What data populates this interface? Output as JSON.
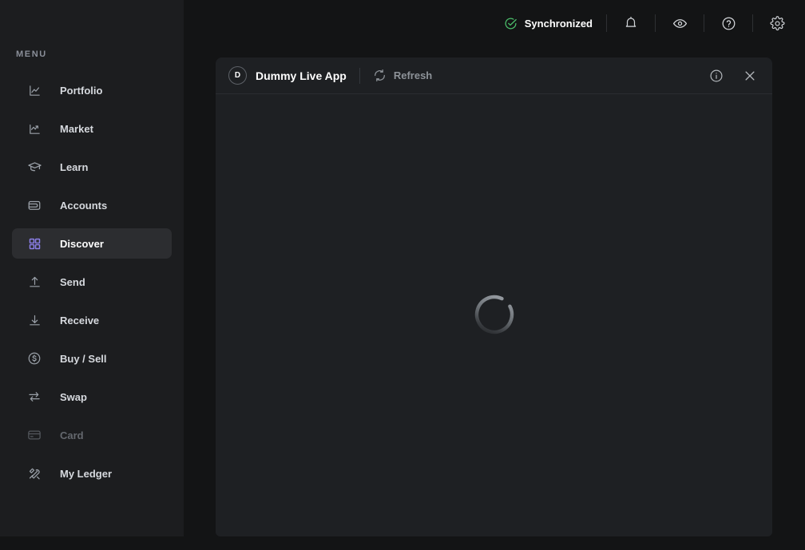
{
  "colors": {
    "app_background": "#131415",
    "sidebar_background": "#1c1d1f",
    "panel_background": "#1e2023",
    "active_item_background": "#2c2d30",
    "accent_purple": "#8b7fe8",
    "status_green": "#4bbf6b",
    "text_primary": "#ffffff",
    "text_secondary": "#8d9298",
    "text_disabled": "#64686e"
  },
  "sidebar": {
    "section_label": "MENU",
    "items": [
      {
        "label": "Portfolio",
        "icon": "line-chart-icon",
        "active": false,
        "disabled": false
      },
      {
        "label": "Market",
        "icon": "trending-up-icon",
        "active": false,
        "disabled": false
      },
      {
        "label": "Learn",
        "icon": "graduation-cap-icon",
        "active": false,
        "disabled": false
      },
      {
        "label": "Accounts",
        "icon": "wallet-icon",
        "active": false,
        "disabled": false
      },
      {
        "label": "Discover",
        "icon": "grid-squares-icon",
        "active": true,
        "disabled": false
      },
      {
        "label": "Send",
        "icon": "arrow-up-tray-icon",
        "active": false,
        "disabled": false
      },
      {
        "label": "Receive",
        "icon": "arrow-down-icon",
        "active": false,
        "disabled": false
      },
      {
        "label": "Buy / Sell",
        "icon": "dollar-circle-icon",
        "active": false,
        "disabled": false
      },
      {
        "label": "Swap",
        "icon": "swap-arrows-icon",
        "active": false,
        "disabled": false
      },
      {
        "label": "Card",
        "icon": "credit-card-icon",
        "active": false,
        "disabled": true
      },
      {
        "label": "My Ledger",
        "icon": "tools-icon",
        "active": false,
        "disabled": false
      }
    ]
  },
  "topbar": {
    "sync_status_label": "Synchronized",
    "sync_status_icon": "check-circle-icon",
    "buttons": [
      {
        "name": "notifications-button",
        "icon": "bell-icon"
      },
      {
        "name": "discreet-mode-button",
        "icon": "eye-icon"
      },
      {
        "name": "help-button",
        "icon": "question-circle-icon"
      },
      {
        "name": "settings-button",
        "icon": "gear-icon"
      }
    ]
  },
  "live_app": {
    "badge_letter": "D",
    "title": "Dummy Live App",
    "refresh_label": "Refresh",
    "refresh_icon": "refresh-icon",
    "info_icon": "info-circle-icon",
    "close_icon": "close-icon",
    "loading": true,
    "loading_label": "Loading"
  }
}
